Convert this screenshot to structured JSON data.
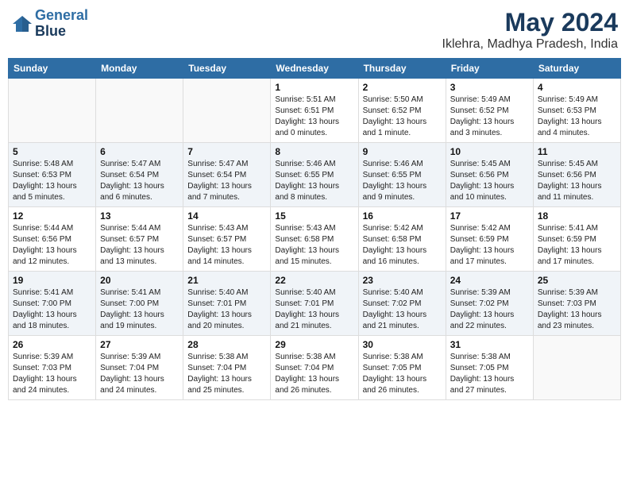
{
  "header": {
    "logo_line1": "General",
    "logo_line2": "Blue",
    "title": "May 2024",
    "subtitle": "Iklehra, Madhya Pradesh, India"
  },
  "calendar": {
    "days_of_week": [
      "Sunday",
      "Monday",
      "Tuesday",
      "Wednesday",
      "Thursday",
      "Friday",
      "Saturday"
    ],
    "weeks": [
      [
        {
          "day": "",
          "info": ""
        },
        {
          "day": "",
          "info": ""
        },
        {
          "day": "",
          "info": ""
        },
        {
          "day": "1",
          "info": "Sunrise: 5:51 AM\nSunset: 6:51 PM\nDaylight: 13 hours\nand 0 minutes."
        },
        {
          "day": "2",
          "info": "Sunrise: 5:50 AM\nSunset: 6:52 PM\nDaylight: 13 hours\nand 1 minute."
        },
        {
          "day": "3",
          "info": "Sunrise: 5:49 AM\nSunset: 6:52 PM\nDaylight: 13 hours\nand 3 minutes."
        },
        {
          "day": "4",
          "info": "Sunrise: 5:49 AM\nSunset: 6:53 PM\nDaylight: 13 hours\nand 4 minutes."
        }
      ],
      [
        {
          "day": "5",
          "info": "Sunrise: 5:48 AM\nSunset: 6:53 PM\nDaylight: 13 hours\nand 5 minutes."
        },
        {
          "day": "6",
          "info": "Sunrise: 5:47 AM\nSunset: 6:54 PM\nDaylight: 13 hours\nand 6 minutes."
        },
        {
          "day": "7",
          "info": "Sunrise: 5:47 AM\nSunset: 6:54 PM\nDaylight: 13 hours\nand 7 minutes."
        },
        {
          "day": "8",
          "info": "Sunrise: 5:46 AM\nSunset: 6:55 PM\nDaylight: 13 hours\nand 8 minutes."
        },
        {
          "day": "9",
          "info": "Sunrise: 5:46 AM\nSunset: 6:55 PM\nDaylight: 13 hours\nand 9 minutes."
        },
        {
          "day": "10",
          "info": "Sunrise: 5:45 AM\nSunset: 6:56 PM\nDaylight: 13 hours\nand 10 minutes."
        },
        {
          "day": "11",
          "info": "Sunrise: 5:45 AM\nSunset: 6:56 PM\nDaylight: 13 hours\nand 11 minutes."
        }
      ],
      [
        {
          "day": "12",
          "info": "Sunrise: 5:44 AM\nSunset: 6:56 PM\nDaylight: 13 hours\nand 12 minutes."
        },
        {
          "day": "13",
          "info": "Sunrise: 5:44 AM\nSunset: 6:57 PM\nDaylight: 13 hours\nand 13 minutes."
        },
        {
          "day": "14",
          "info": "Sunrise: 5:43 AM\nSunset: 6:57 PM\nDaylight: 13 hours\nand 14 minutes."
        },
        {
          "day": "15",
          "info": "Sunrise: 5:43 AM\nSunset: 6:58 PM\nDaylight: 13 hours\nand 15 minutes."
        },
        {
          "day": "16",
          "info": "Sunrise: 5:42 AM\nSunset: 6:58 PM\nDaylight: 13 hours\nand 16 minutes."
        },
        {
          "day": "17",
          "info": "Sunrise: 5:42 AM\nSunset: 6:59 PM\nDaylight: 13 hours\nand 17 minutes."
        },
        {
          "day": "18",
          "info": "Sunrise: 5:41 AM\nSunset: 6:59 PM\nDaylight: 13 hours\nand 17 minutes."
        }
      ],
      [
        {
          "day": "19",
          "info": "Sunrise: 5:41 AM\nSunset: 7:00 PM\nDaylight: 13 hours\nand 18 minutes."
        },
        {
          "day": "20",
          "info": "Sunrise: 5:41 AM\nSunset: 7:00 PM\nDaylight: 13 hours\nand 19 minutes."
        },
        {
          "day": "21",
          "info": "Sunrise: 5:40 AM\nSunset: 7:01 PM\nDaylight: 13 hours\nand 20 minutes."
        },
        {
          "day": "22",
          "info": "Sunrise: 5:40 AM\nSunset: 7:01 PM\nDaylight: 13 hours\nand 21 minutes."
        },
        {
          "day": "23",
          "info": "Sunrise: 5:40 AM\nSunset: 7:02 PM\nDaylight: 13 hours\nand 21 minutes."
        },
        {
          "day": "24",
          "info": "Sunrise: 5:39 AM\nSunset: 7:02 PM\nDaylight: 13 hours\nand 22 minutes."
        },
        {
          "day": "25",
          "info": "Sunrise: 5:39 AM\nSunset: 7:03 PM\nDaylight: 13 hours\nand 23 minutes."
        }
      ],
      [
        {
          "day": "26",
          "info": "Sunrise: 5:39 AM\nSunset: 7:03 PM\nDaylight: 13 hours\nand 24 minutes."
        },
        {
          "day": "27",
          "info": "Sunrise: 5:39 AM\nSunset: 7:04 PM\nDaylight: 13 hours\nand 24 minutes."
        },
        {
          "day": "28",
          "info": "Sunrise: 5:38 AM\nSunset: 7:04 PM\nDaylight: 13 hours\nand 25 minutes."
        },
        {
          "day": "29",
          "info": "Sunrise: 5:38 AM\nSunset: 7:04 PM\nDaylight: 13 hours\nand 26 minutes."
        },
        {
          "day": "30",
          "info": "Sunrise: 5:38 AM\nSunset: 7:05 PM\nDaylight: 13 hours\nand 26 minutes."
        },
        {
          "day": "31",
          "info": "Sunrise: 5:38 AM\nSunset: 7:05 PM\nDaylight: 13 hours\nand 27 minutes."
        },
        {
          "day": "",
          "info": ""
        }
      ]
    ]
  }
}
